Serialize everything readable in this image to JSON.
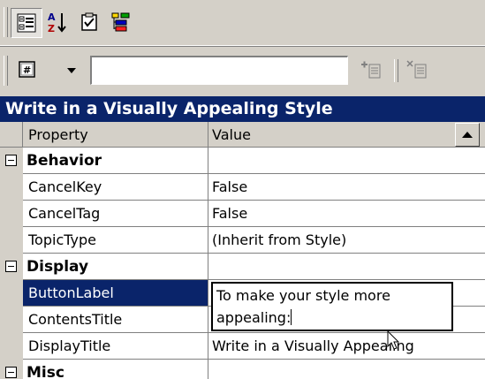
{
  "toolbar": {
    "buttons": [
      {
        "name": "categorized-view",
        "icon": "categorized-icon",
        "pressed": true
      },
      {
        "name": "alphabetical-sort",
        "icon": "sort-az-icon",
        "pressed": false
      },
      {
        "name": "property-pages",
        "icon": "checklist-icon",
        "pressed": false
      },
      {
        "name": "object-browser",
        "icon": "properties-icon",
        "pressed": false
      }
    ],
    "object_selector": {
      "icon": "object-icon",
      "value": ""
    },
    "add_button_icon": "add-item-icon",
    "delete_button_icon": "delete-item-icon"
  },
  "title": "Write in a Visually Appealing Style",
  "grid": {
    "columns": [
      "Property",
      "Value"
    ],
    "rows": [
      {
        "type": "category",
        "label": "Behavior",
        "value": ""
      },
      {
        "type": "property",
        "label": "CancelKey",
        "value": "False"
      },
      {
        "type": "property",
        "label": "CancelTag",
        "value": "False"
      },
      {
        "type": "property",
        "label": "TopicType",
        "value": "(Inherit from Style)"
      },
      {
        "type": "category",
        "label": "Display",
        "value": ""
      },
      {
        "type": "property",
        "label": "ButtonLabel",
        "value": "",
        "selected": true
      },
      {
        "type": "property",
        "label": "ContentsTitle",
        "value": ""
      },
      {
        "type": "property",
        "label": "DisplayTitle",
        "value": "Write in a Visually Appealing"
      },
      {
        "type": "category",
        "label": "Misc",
        "value": ""
      }
    ]
  },
  "editor": {
    "line1": "To make your style more",
    "line2": "appealing:"
  },
  "colors": {
    "selection": "#0a246a",
    "face": "#d4d0c8"
  }
}
